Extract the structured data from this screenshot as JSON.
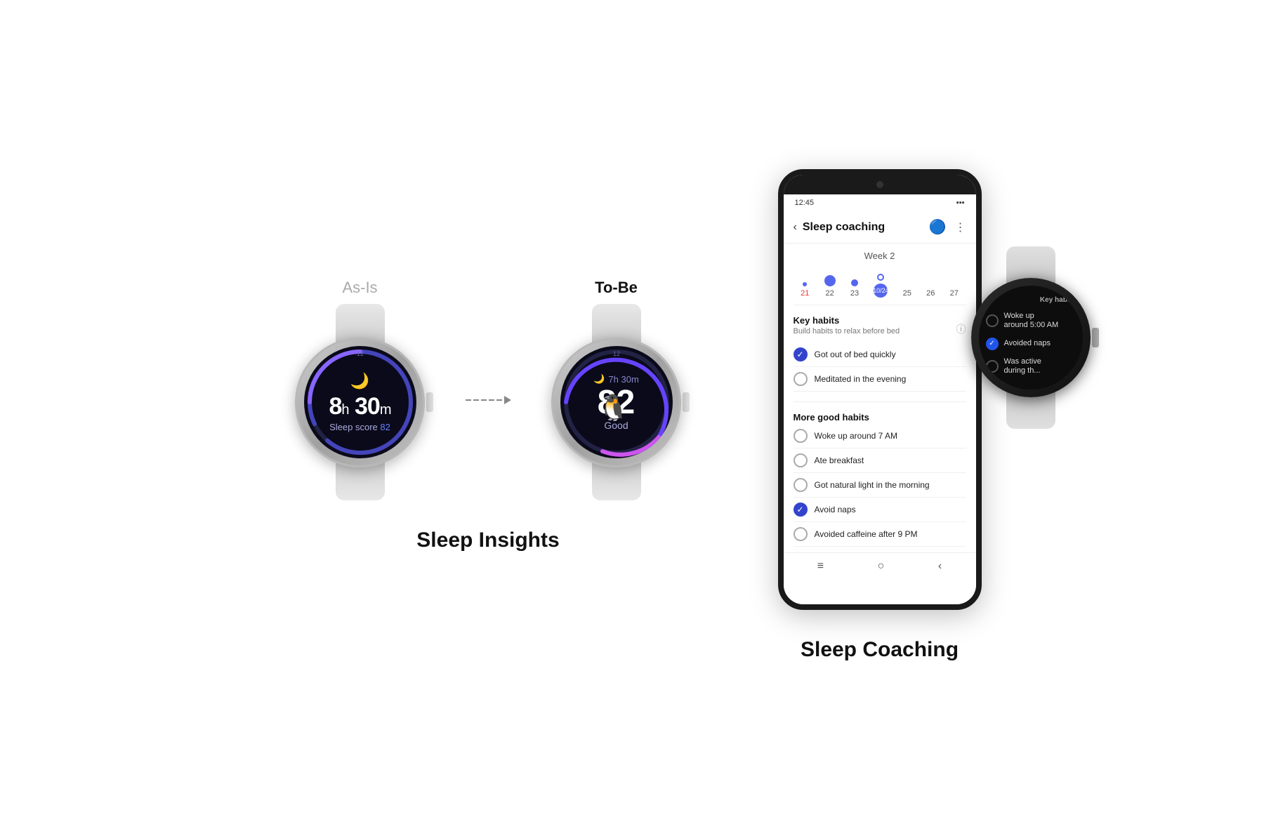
{
  "left_section": {
    "label_asis": "As-Is",
    "label_tobe": "To-Be",
    "watch1": {
      "time": "8h 30m",
      "score_label": "Sleep score",
      "score_value": "82"
    },
    "watch2": {
      "time_label": "7h 30m",
      "score": "82",
      "quality": "Good"
    },
    "section_title": "Sleep Insights"
  },
  "right_section": {
    "phone": {
      "status_time": "12:45",
      "header_title": "Sleep coaching",
      "week_label": "Week 2",
      "calendar": {
        "days": [
          "21",
          "22",
          "23",
          "10/24",
          "25",
          "26",
          "27"
        ]
      },
      "key_habits": {
        "title": "Key habits",
        "subtitle": "Build habits to relax before bed",
        "items": [
          {
            "text": "Got out of bed quickly",
            "checked": true
          },
          {
            "text": "Meditated in the evening",
            "checked": false
          }
        ]
      },
      "more_habits": {
        "title": "More good habits",
        "items": [
          {
            "text": "Woke up around 7 AM",
            "checked": false
          },
          {
            "text": "Ate breakfast",
            "checked": false
          },
          {
            "text": "Got natural light in the morning",
            "checked": false
          },
          {
            "text": "Avoid naps",
            "checked": true
          },
          {
            "text": "Avoided caffeine after 9 PM",
            "checked": false
          }
        ]
      }
    },
    "watch": {
      "header": "Key habits",
      "items": [
        {
          "text": "Woke up around 5:00 AM",
          "checked": false
        },
        {
          "text": "Avoided naps",
          "checked": true
        },
        {
          "text": "Was active during th...",
          "checked": false
        }
      ]
    },
    "section_title": "Sleep Coaching"
  }
}
